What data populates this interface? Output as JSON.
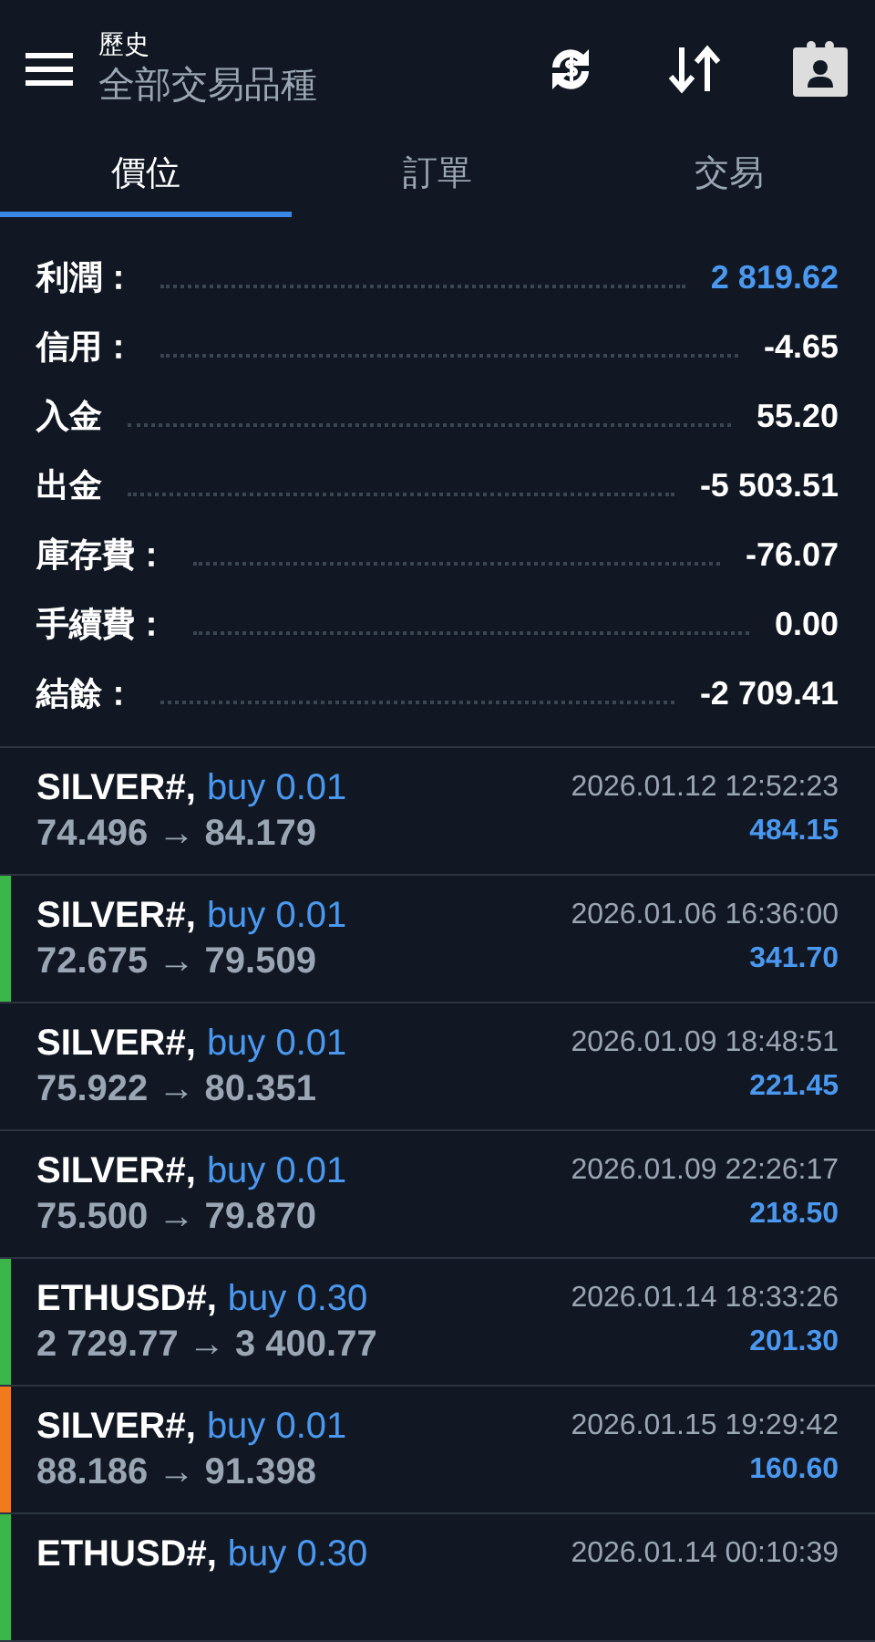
{
  "header": {
    "title": "歷史",
    "subtitle": "全部交易品種"
  },
  "tabs": [
    {
      "label": "價位",
      "selected": true
    },
    {
      "label": "訂單",
      "selected": false
    },
    {
      "label": "交易",
      "selected": false
    }
  ],
  "summary": [
    {
      "label": "利潤：",
      "value": "2 819.62",
      "highlight": true
    },
    {
      "label": "信用：",
      "value": "-4.65",
      "highlight": false
    },
    {
      "label": "入金",
      "value": "55.20",
      "highlight": false
    },
    {
      "label": "出金",
      "value": "-5 503.51",
      "highlight": false
    },
    {
      "label": "庫存費：",
      "value": "-76.07",
      "highlight": false
    },
    {
      "label": "手續費：",
      "value": "0.00",
      "highlight": false
    },
    {
      "label": "結餘：",
      "value": "-2 709.41",
      "highlight": false
    }
  ],
  "trades": [
    {
      "symbol": "SILVER#,",
      "side": "buy 0.01",
      "prices": "74.496 → 84.179",
      "time": "2026.01.12 12:52:23",
      "profit": "484.15"
    },
    {
      "symbol": "SILVER#,",
      "side": "buy 0.01",
      "prices": "72.675 → 79.509",
      "time": "2026.01.06 16:36:00",
      "profit": "341.70",
      "color": "#3cb54a"
    },
    {
      "symbol": "SILVER#,",
      "side": "buy 0.01",
      "prices": "75.922 → 80.351",
      "time": "2026.01.09 18:48:51",
      "profit": "221.45"
    },
    {
      "symbol": "SILVER#,",
      "side": "buy 0.01",
      "prices": "75.500 → 79.870",
      "time": "2026.01.09 22:26:17",
      "profit": "218.50"
    },
    {
      "symbol": "ETHUSD#,",
      "side": "buy 0.30",
      "prices": "2 729.77 → 3 400.77",
      "time": "2026.01.14 18:33:26",
      "profit": "201.30",
      "color": "#3cb54a"
    },
    {
      "symbol": "SILVER#,",
      "side": "buy 0.01",
      "prices": "88.186 → 91.398",
      "time": "2026.01.15 19:29:42",
      "profit": "160.60",
      "color": "#f07a1c"
    },
    {
      "symbol": "ETHUSD#,",
      "side": "buy 0.30",
      "time": "2026.01.14 00:10:39",
      "color": "#3cb54a"
    }
  ]
}
